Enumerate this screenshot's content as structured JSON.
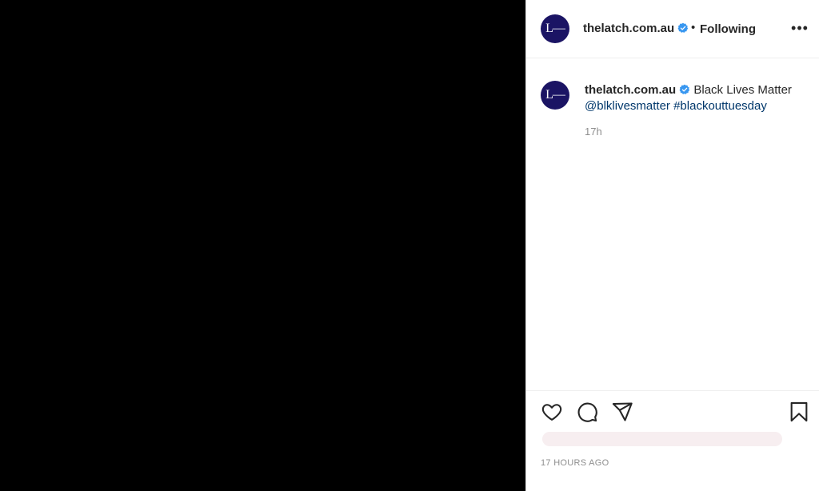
{
  "post": {
    "author": "thelatch.com.au",
    "avatar_text": "L—",
    "follow_separator": "•",
    "follow_status": "Following",
    "more_icon": "•••",
    "caption": {
      "username": "thelatch.com.au",
      "text": "Black Lives Matter",
      "mention": "@blklivesmatter",
      "hashtag": "#blackouttuesday",
      "age": "17h"
    },
    "timestamp": "17 HOURS AGO"
  },
  "colors": {
    "verified": "#3897f0",
    "avatar_bg": "#1b1464",
    "link": "#00376b"
  },
  "icons": [
    "heart-icon",
    "comment-icon",
    "share-icon",
    "bookmark-icon",
    "verified-badge-icon",
    "more-options-icon"
  ]
}
